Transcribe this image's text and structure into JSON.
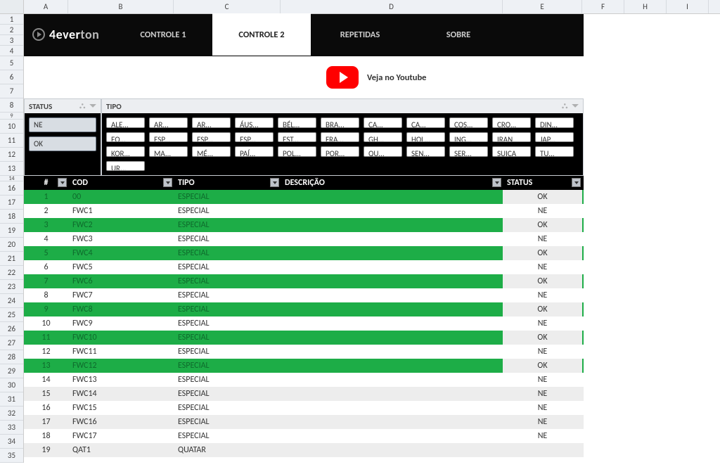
{
  "brand": {
    "name_a": "4ever",
    "name_b": "ton"
  },
  "column_letters": [
    "A",
    "B",
    "C",
    "D",
    "E",
    "F",
    "H",
    "I"
  ],
  "row_numbers_top": [
    "1",
    "2",
    "3",
    "4",
    "5",
    "6",
    "7",
    "8",
    "9",
    "10",
    "11",
    "12",
    "13",
    "14",
    "16",
    "17",
    "18",
    "19",
    "20",
    "21",
    "22",
    "23",
    "24",
    "25",
    "26",
    "27",
    "28",
    "29",
    "30",
    "31",
    "32",
    "33",
    "34",
    "35"
  ],
  "nav": {
    "tabs": [
      "CONTROLE 1",
      "CONTROLE 2",
      "REPETIDAS",
      "SOBRE"
    ],
    "active": "CONTROLE 2"
  },
  "youtube": {
    "label": "Veja no Youtube"
  },
  "slicers": {
    "status": {
      "title": "STATUS",
      "items": [
        "NE",
        "OK"
      ],
      "selected": [
        "NE",
        "OK"
      ]
    },
    "tipo": {
      "title": "TIPO",
      "items": [
        "ALE...",
        "AR...",
        "AR...",
        "ÁUS...",
        "BÉL...",
        "BRA...",
        "CA...",
        "CA...",
        "COS...",
        "CRO...",
        "DIN...",
        "EQ...",
        "ESP...",
        "ESP...",
        "ESP...",
        "EST...",
        "FRA...",
        "GH...",
        "HOL...",
        "ING...",
        "IRAN",
        "JAP...",
        "KOR...",
        "MA...",
        "MÉ...",
        "PAÍ...",
        "POL...",
        "POR...",
        "QU...",
        "SEN...",
        "SER...",
        "SUIÇA",
        "TU...",
        "UR..."
      ]
    }
  },
  "table": {
    "headers": {
      "num": "#",
      "cod": "COD",
      "tipo": "TIPO",
      "desc": "DESCRIÇÃO",
      "status": "STATUS"
    },
    "rows": [
      {
        "n": "1",
        "cod": "00",
        "tipo": "ESPECIAL",
        "desc": "",
        "status": "OK",
        "green": true
      },
      {
        "n": "2",
        "cod": "FWC1",
        "tipo": "ESPECIAL",
        "desc": "",
        "status": "NE",
        "green": false
      },
      {
        "n": "3",
        "cod": "FWC2",
        "tipo": "ESPECIAL",
        "desc": "",
        "status": "OK",
        "green": true
      },
      {
        "n": "4",
        "cod": "FWC3",
        "tipo": "ESPECIAL",
        "desc": "",
        "status": "NE",
        "green": false
      },
      {
        "n": "5",
        "cod": "FWC4",
        "tipo": "ESPECIAL",
        "desc": "",
        "status": "OK",
        "green": true
      },
      {
        "n": "6",
        "cod": "FWC5",
        "tipo": "ESPECIAL",
        "desc": "",
        "status": "NE",
        "green": false
      },
      {
        "n": "7",
        "cod": "FWC6",
        "tipo": "ESPECIAL",
        "desc": "",
        "status": "OK",
        "green": true
      },
      {
        "n": "8",
        "cod": "FWC7",
        "tipo": "ESPECIAL",
        "desc": "",
        "status": "NE",
        "green": false
      },
      {
        "n": "9",
        "cod": "FWC8",
        "tipo": "ESPECIAL",
        "desc": "",
        "status": "OK",
        "green": true
      },
      {
        "n": "10",
        "cod": "FWC9",
        "tipo": "ESPECIAL",
        "desc": "",
        "status": "NE",
        "green": false
      },
      {
        "n": "11",
        "cod": "FWC10",
        "tipo": "ESPECIAL",
        "desc": "",
        "status": "OK",
        "green": true
      },
      {
        "n": "12",
        "cod": "FWC11",
        "tipo": "ESPECIAL",
        "desc": "",
        "status": "NE",
        "green": false
      },
      {
        "n": "13",
        "cod": "FWC12",
        "tipo": "ESPECIAL",
        "desc": "",
        "status": "OK",
        "green": true
      },
      {
        "n": "14",
        "cod": "FWC13",
        "tipo": "ESPECIAL",
        "desc": "",
        "status": "NE",
        "green": false
      },
      {
        "n": "15",
        "cod": "FWC14",
        "tipo": "ESPECIAL",
        "desc": "",
        "status": "NE",
        "green": false,
        "striped": true
      },
      {
        "n": "16",
        "cod": "FWC15",
        "tipo": "ESPECIAL",
        "desc": "",
        "status": "NE",
        "green": false
      },
      {
        "n": "17",
        "cod": "FWC16",
        "tipo": "ESPECIAL",
        "desc": "",
        "status": "NE",
        "green": false,
        "striped": true
      },
      {
        "n": "18",
        "cod": "FWC17",
        "tipo": "ESPECIAL",
        "desc": "",
        "status": "NE",
        "green": false
      },
      {
        "n": "19",
        "cod": "QAT1",
        "tipo": "QUATAR",
        "desc": "",
        "status": "",
        "green": false,
        "striped": true
      }
    ]
  }
}
